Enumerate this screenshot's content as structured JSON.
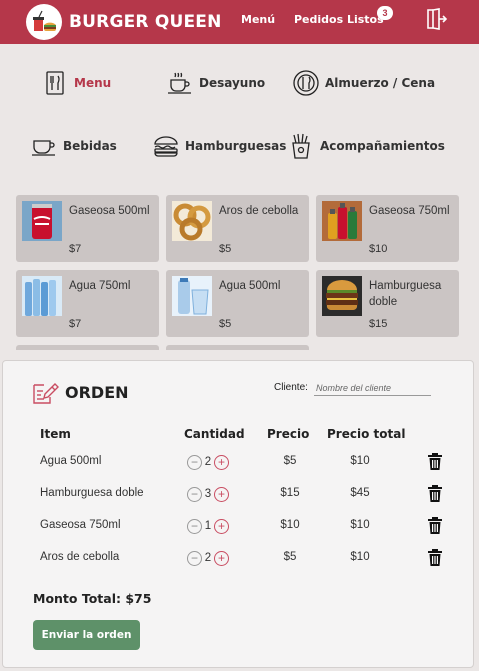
{
  "header": {
    "brand": "BURGER QUEEN",
    "nav_menu": "Menú",
    "nav_orders": "Pedidos Listos",
    "orders_badge": "3",
    "bg_color": "#b5374a"
  },
  "categories": [
    {
      "label": "Menu",
      "icon": "menu-book-icon",
      "active": true
    },
    {
      "label": "Desayuno",
      "icon": "coffee-cup-icon"
    },
    {
      "label": "Almuerzo / Cena",
      "icon": "plate-cutlery-icon"
    },
    {
      "label": "Bebidas",
      "icon": "tea-cup-icon"
    },
    {
      "label": "Hamburguesas",
      "icon": "burger-icon"
    },
    {
      "label": "Acompañamientos",
      "icon": "fries-icon"
    }
  ],
  "products": [
    {
      "name": "Gaseosa 500ml",
      "price": "$7",
      "image": "cola-can-image"
    },
    {
      "name": "Aros de cebolla",
      "price": "$5",
      "image": "onion-rings-image"
    },
    {
      "name": "Gaseosa 750ml",
      "price": "$10",
      "image": "soda-bottles-image"
    },
    {
      "name": "Agua 750ml",
      "price": "$7",
      "image": "water-bottles-image"
    },
    {
      "name": "Agua 500ml",
      "price": "$5",
      "image": "water-glass-image"
    },
    {
      "name": "Hamburguesa doble",
      "price": "$15",
      "image": "double-burger-image"
    }
  ],
  "order": {
    "title": "ORDEN",
    "client_label": "Cliente:",
    "client_placeholder": "Nombre del cliente",
    "columns": {
      "item": "Item",
      "qty": "Cantidad",
      "price": "Precio",
      "total": "Precio total"
    },
    "rows": [
      {
        "item": "Agua 500ml",
        "qty": "2",
        "price": "$5",
        "total": "$10"
      },
      {
        "item": "Hamburguesa doble",
        "qty": "3",
        "price": "$15",
        "total": "$45"
      },
      {
        "item": "Gaseosa 750ml",
        "qty": "1",
        "price": "$10",
        "total": "$10"
      },
      {
        "item": "Aros de cebolla",
        "qty": "2",
        "price": "$5",
        "total": "$10"
      }
    ],
    "total_label": "Monto Total: $75",
    "send_label": "Enviar la orden",
    "send_color": "#5e9169"
  }
}
